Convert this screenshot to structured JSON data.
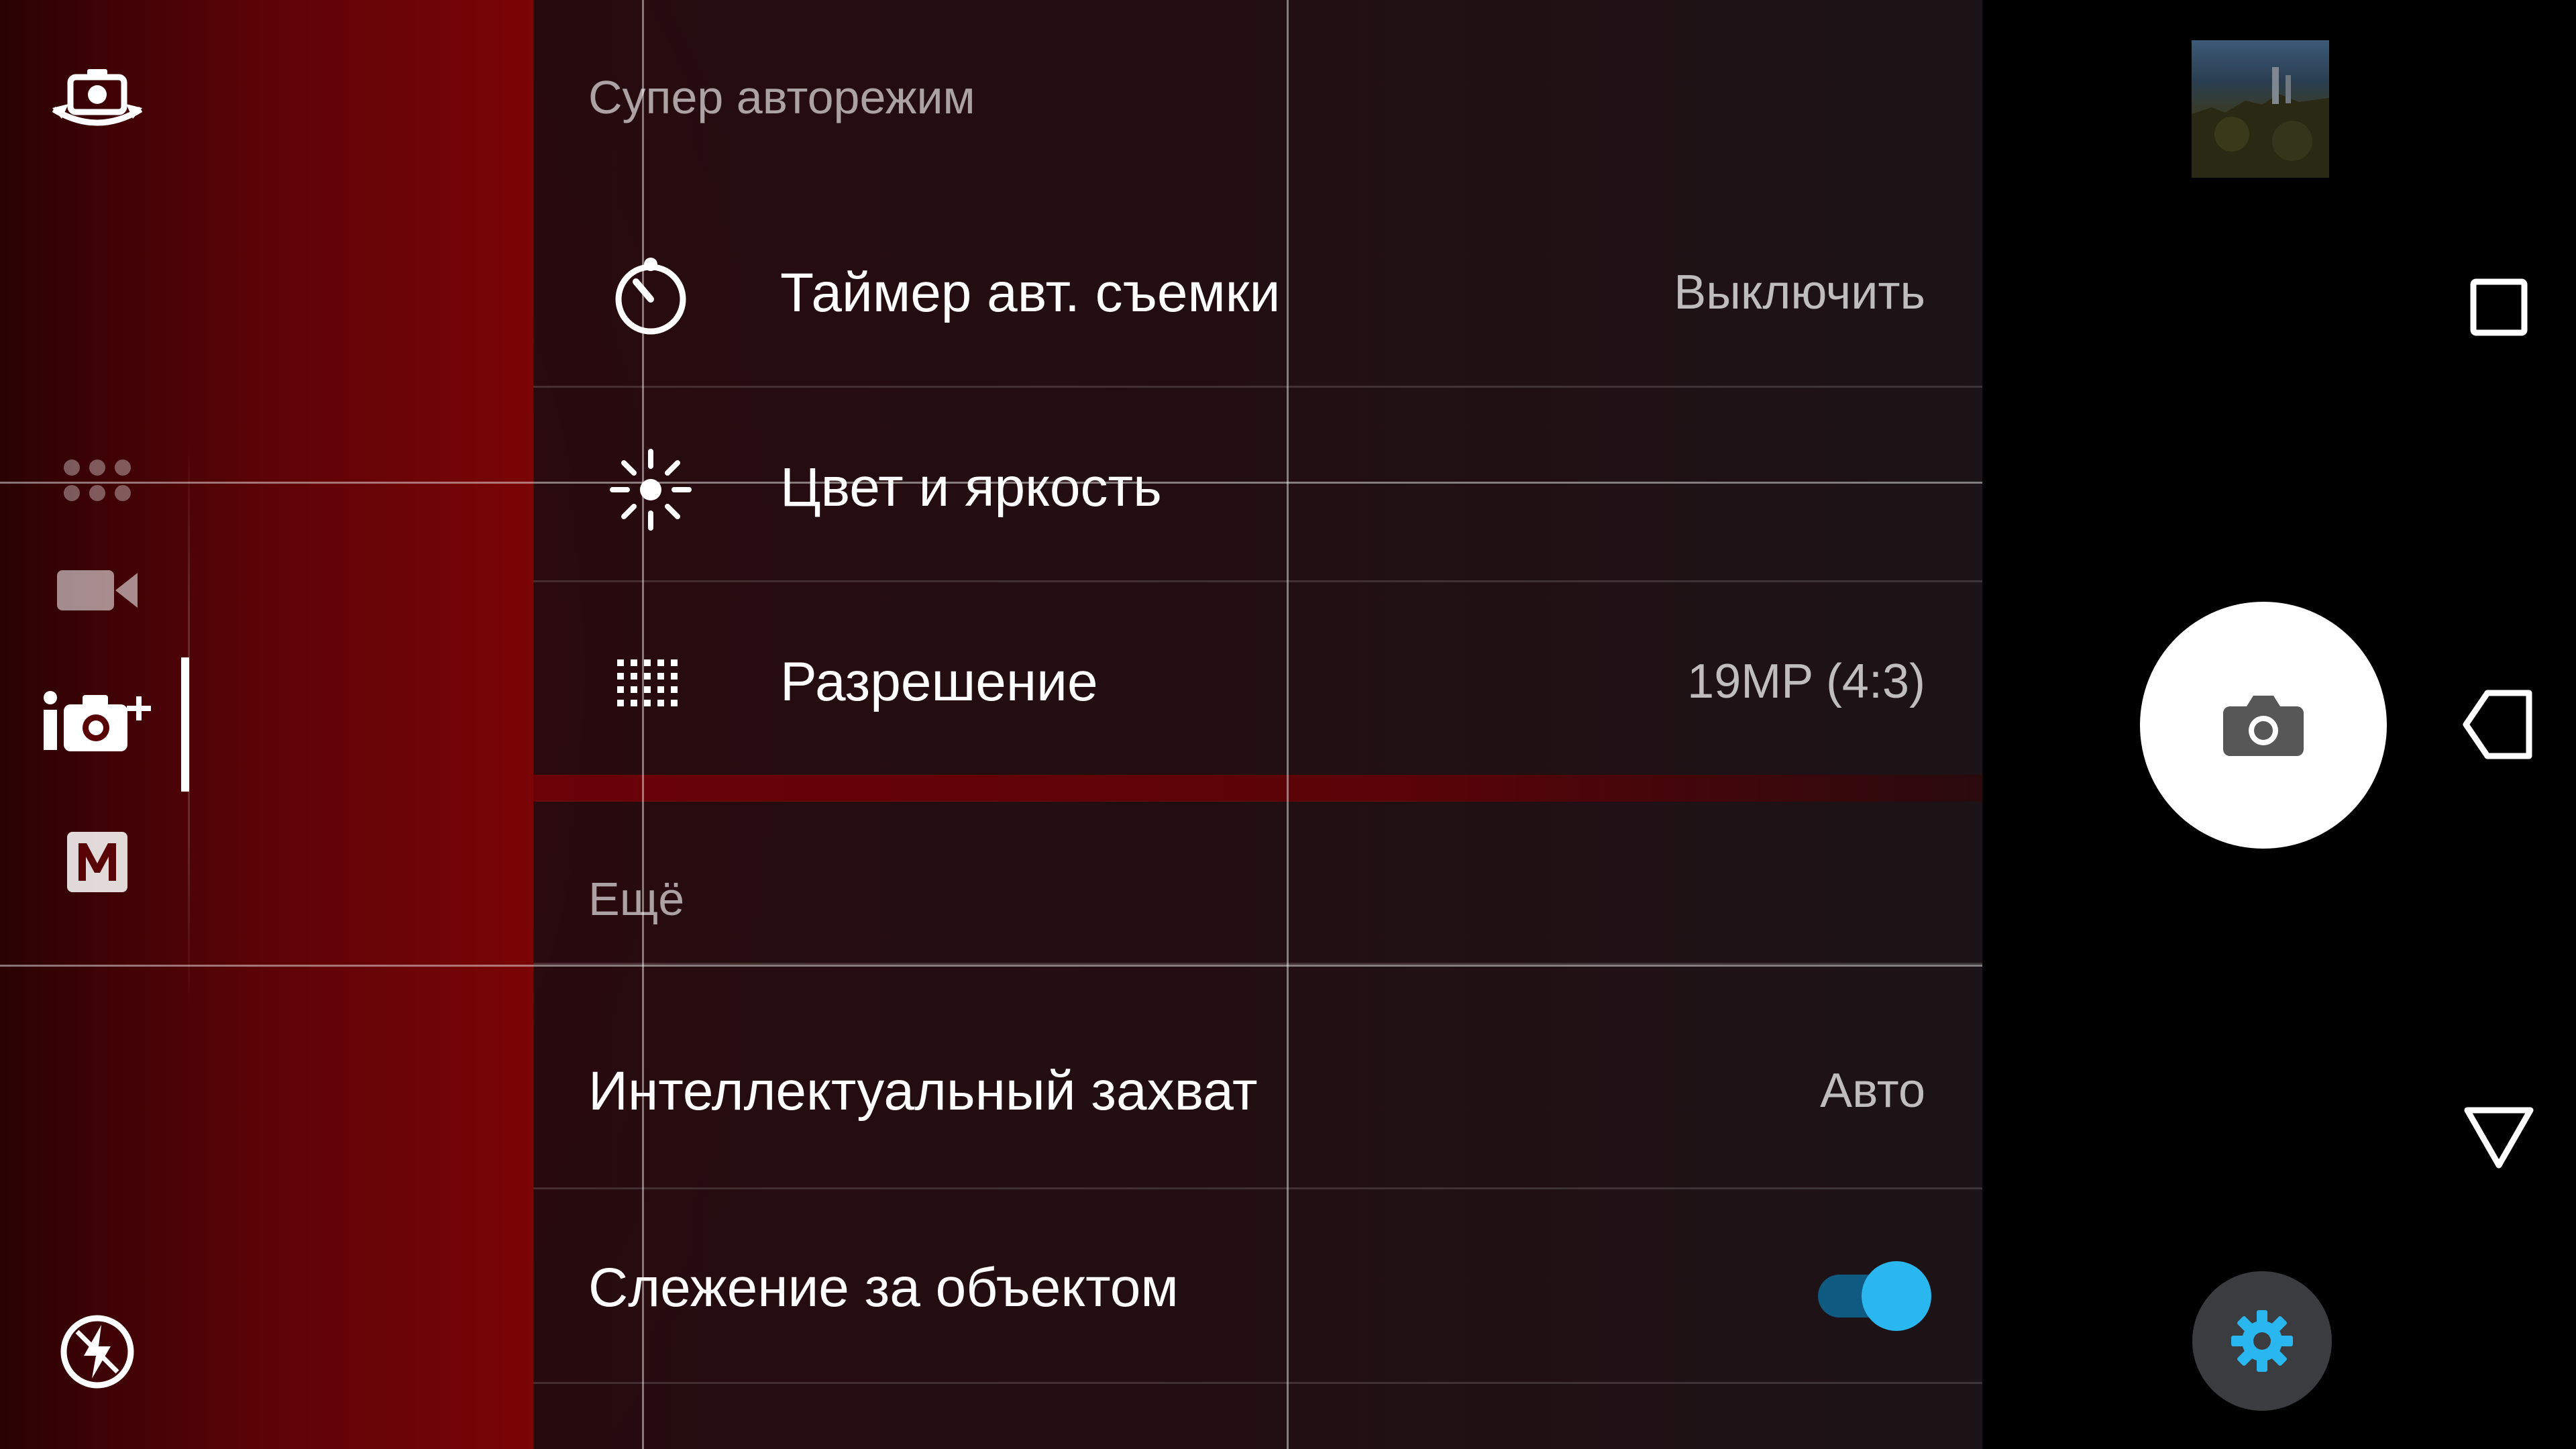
{
  "left_rail": {
    "items": [
      {
        "icon": "switch-camera-icon"
      },
      {
        "icon": "more-modes-icon"
      },
      {
        "icon": "video-camera-icon"
      },
      {
        "icon": "superior-auto-icon",
        "active": true
      },
      {
        "icon": "manual-mode-icon",
        "letter": "M"
      },
      {
        "icon": "flash-auto-icon"
      }
    ]
  },
  "settings": {
    "section1_title": "Супер авторежим",
    "timer": {
      "label": "Таймер авт. съемки",
      "value": "Выключить"
    },
    "color": {
      "label": "Цвет и яркость"
    },
    "resolution": {
      "label": "Разрешение",
      "value": "19MP (4:3)"
    },
    "section2_title": "Ещё",
    "smart_capture": {
      "label": "Интеллектуальный захват",
      "value": "Авто"
    },
    "tracking": {
      "label": "Слежение за объектом",
      "enabled": true
    }
  },
  "right_panel": {
    "thumbnail": "last-photo-thumbnail",
    "shutter_icon": "camera-icon",
    "settings_icon": "gear-icon",
    "nav": [
      "recent-apps-icon",
      "back-icon",
      "home-icon"
    ]
  },
  "colors": {
    "accent": "#2ab6ee",
    "rail_red": "#7a0406",
    "panel": "#2a1216"
  }
}
